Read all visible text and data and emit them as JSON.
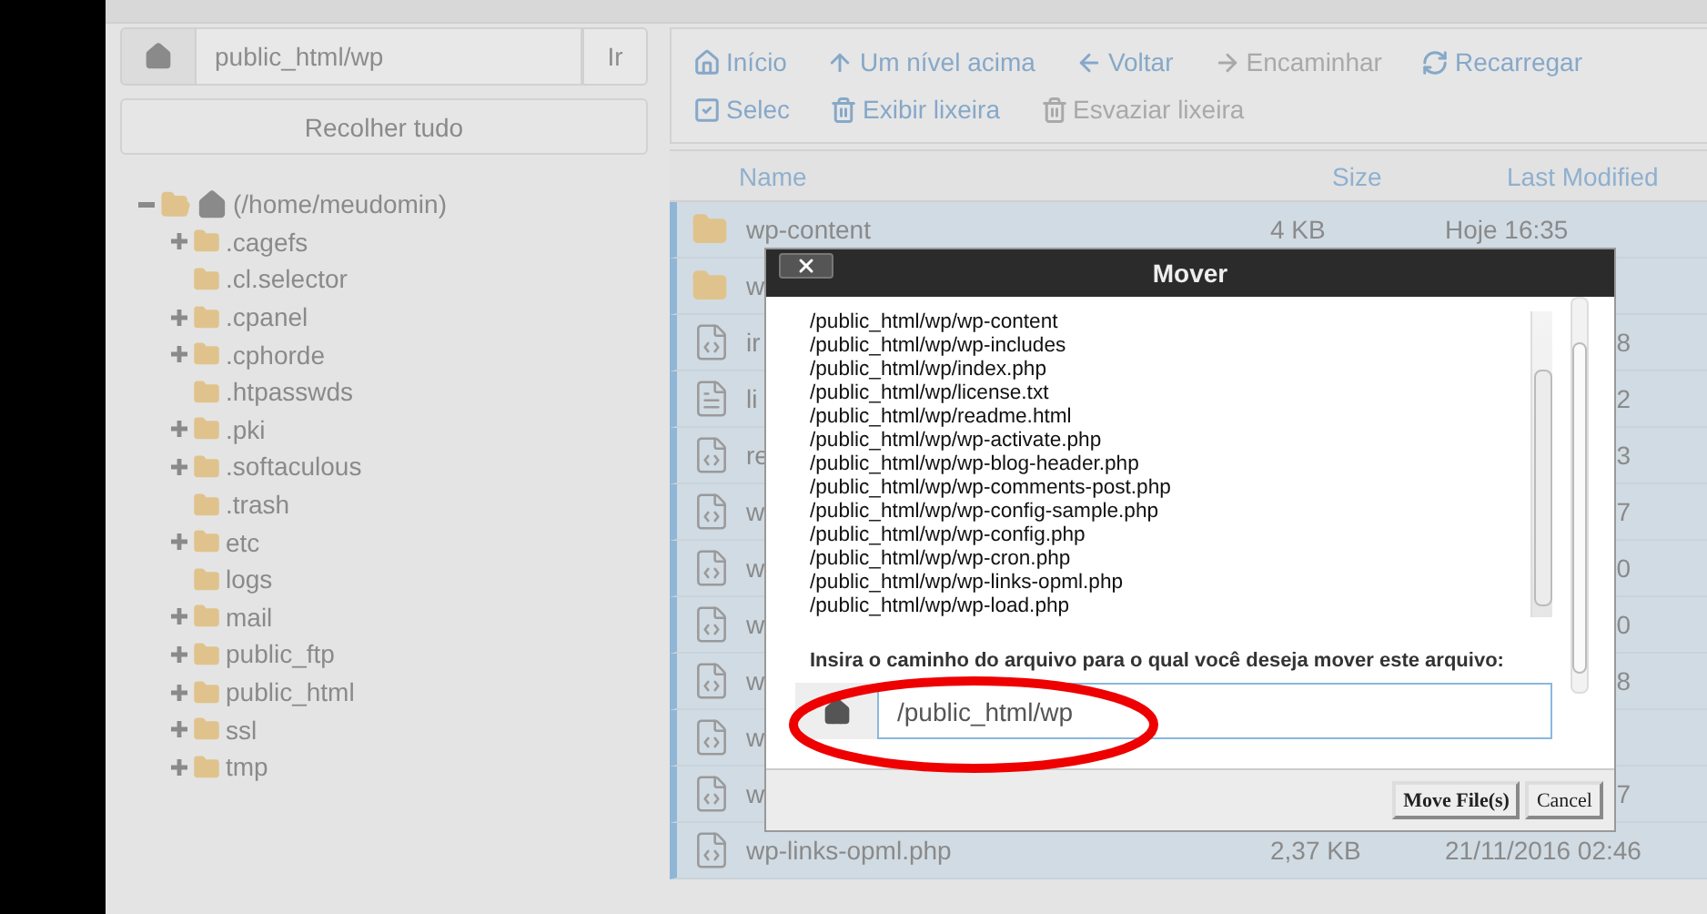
{
  "address_bar": {
    "value": "public_html/wp",
    "button": "Ir"
  },
  "collapse_button": "Recolher tudo",
  "tree": {
    "label": "(/home/meudomin)",
    "expanded": true,
    "children": [
      {
        "label": ".cagefs",
        "expandable": true
      },
      {
        "label": ".cl.selector",
        "expandable": false
      },
      {
        "label": ".cpanel",
        "expandable": true
      },
      {
        "label": ".cphorde",
        "expandable": true
      },
      {
        "label": ".htpasswds",
        "expandable": false
      },
      {
        "label": ".pki",
        "expandable": true
      },
      {
        "label": ".softaculous",
        "expandable": true
      },
      {
        "label": ".trash",
        "expandable": false
      },
      {
        "label": "etc",
        "expandable": true
      },
      {
        "label": "logs",
        "expandable": false
      },
      {
        "label": "mail",
        "expandable": true
      },
      {
        "label": "public_ftp",
        "expandable": true
      },
      {
        "label": "public_html",
        "expandable": true
      },
      {
        "label": "ssl",
        "expandable": true
      },
      {
        "label": "tmp",
        "expandable": true
      }
    ]
  },
  "toolbar": [
    {
      "kind": "home",
      "label": "Início",
      "disabled": false
    },
    {
      "kind": "up",
      "label": "Um nível acima",
      "disabled": false
    },
    {
      "kind": "back",
      "label": "Voltar",
      "disabled": false
    },
    {
      "kind": "forward",
      "label": "Encaminhar",
      "disabled": true
    },
    {
      "kind": "reload",
      "label": "Recarregar",
      "disabled": false
    },
    {
      "kind": "select",
      "label": "Selec",
      "disabled": false
    },
    {
      "kind": "trash",
      "label": "Exibir lixeira",
      "disabled": false
    },
    {
      "kind": "trash",
      "label": "Esvaziar lixeira",
      "disabled": true
    }
  ],
  "table": {
    "columns": [
      "Name",
      "Size",
      "Last Modified"
    ],
    "rows": [
      {
        "kind": "folder",
        "name": "wp-content",
        "size": "4 KB",
        "modified": "Hoje 16:35",
        "selected": true
      },
      {
        "kind": "folder",
        "name": "w",
        "size": "",
        "modified": "",
        "selected": true
      },
      {
        "kind": "code",
        "name": "ir",
        "size": "",
        "modified": "8",
        "selected": true
      },
      {
        "kind": "text",
        "name": "li",
        "size": "",
        "modified": "2",
        "selected": true
      },
      {
        "kind": "code",
        "name": "re",
        "size": "",
        "modified": "3",
        "selected": true
      },
      {
        "kind": "code",
        "name": "w",
        "size": "",
        "modified": "7",
        "selected": true
      },
      {
        "kind": "code",
        "name": "w",
        "size": "",
        "modified": "0",
        "selected": true
      },
      {
        "kind": "code",
        "name": "w",
        "size": "",
        "modified": "0",
        "selected": true
      },
      {
        "kind": "code",
        "name": "w",
        "size": "",
        "modified": "8",
        "selected": true
      },
      {
        "kind": "code",
        "name": "w",
        "size": "",
        "modified": "",
        "selected": true
      },
      {
        "kind": "code",
        "name": "w",
        "size": "",
        "modified": "7",
        "selected": true
      },
      {
        "kind": "code",
        "name": "wp-links-opml.php",
        "size": "2,37 KB",
        "modified": "21/11/2016 02:46",
        "selected": true
      }
    ]
  },
  "dialog": {
    "title": "Mover",
    "paths": [
      "/public_html/wp/wp-content",
      "/public_html/wp/wp-includes",
      "/public_html/wp/index.php",
      "/public_html/wp/license.txt",
      "/public_html/wp/readme.html",
      "/public_html/wp/wp-activate.php",
      "/public_html/wp/wp-blog-header.php",
      "/public_html/wp/wp-comments-post.php",
      "/public_html/wp/wp-config-sample.php",
      "/public_html/wp/wp-config.php",
      "/public_html/wp/wp-cron.php",
      "/public_html/wp/wp-links-opml.php",
      "/public_html/wp/wp-load.php"
    ],
    "prompt": "Insira o caminho do arquivo para o qual você deseja mover este arquivo:",
    "value": "/public_html/wp",
    "buttons": [
      {
        "label": "Move File(s)",
        "primary": true
      },
      {
        "label": "Cancel",
        "primary": false
      }
    ]
  }
}
